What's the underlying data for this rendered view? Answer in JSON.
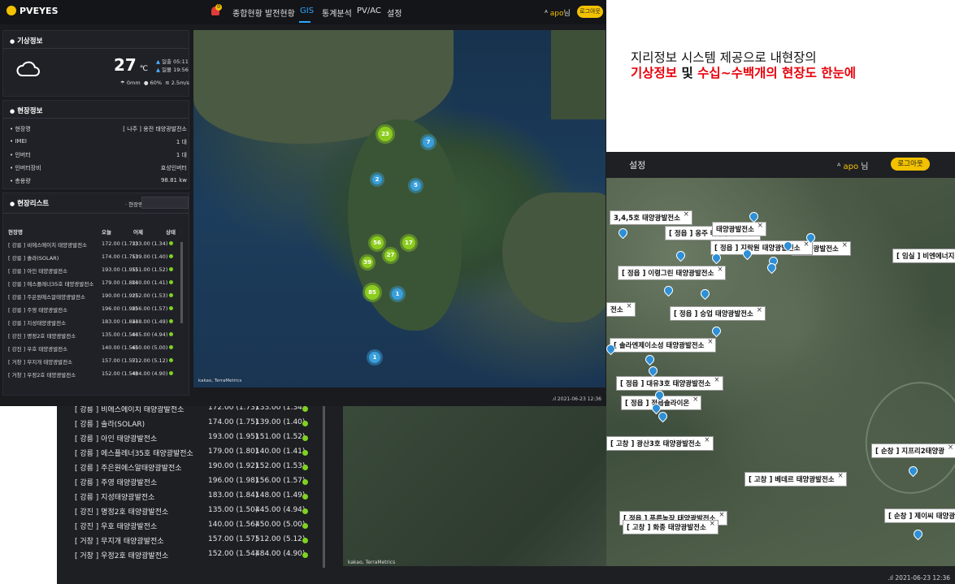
{
  "caption": {
    "line1": "지리정보 시스템 제공으로 내현장의",
    "part1": "기상정보",
    "part2": " 및 ",
    "part3": "수십~수백개의 현장도 한눈에"
  },
  "front": {
    "brand": "PVEYES",
    "bell_count": "0",
    "nav": [
      "종합현황",
      "발전현황",
      "GIS",
      "통계분석",
      "PV/AC",
      "설정"
    ],
    "active_nav": "GIS",
    "user": "apo",
    "user_suffix": "님",
    "logout": "로그아웃",
    "weather": {
      "title": "기상정보",
      "temp": "27",
      "unit": "℃",
      "sunrise": "일출 05:11",
      "sunset": "일몰 19:56",
      "rain": "0mm",
      "humidity": "60%",
      "wind": "2.5m/s"
    },
    "site": {
      "title": "현장정보",
      "rows": [
        {
          "k": "• 현장명",
          "v": "[ 나주 ] 용전 태양광발전소"
        },
        {
          "k": "• IMEI",
          "v": "1 대"
        },
        {
          "k": "• 인버터",
          "v": "1 대"
        },
        {
          "k": "• 인버터장비",
          "v": "효성인버터"
        },
        {
          "k": "• 총용량",
          "v": "98.81 kw"
        }
      ]
    },
    "list": {
      "title": "현장리스트",
      "search_label": "· 현장명",
      "headers": [
        "현장명",
        "오늘",
        "어제",
        "상태"
      ],
      "rows": [
        [
          "[ 강릉 ] 비에스에이치 태양광발전소",
          "172.00 (1.73)",
          "133.00 (1.34)"
        ],
        [
          "[ 강릉 ] 솔라(SOLAR)",
          "174.00 (1.75)",
          "139.00 (1.40)"
        ],
        [
          "[ 강릉 ] 아인 태양광발전소",
          "193.00 (1.95)",
          "151.00 (1.52)"
        ],
        [
          "[ 강릉 ] 에스플레너35호 태양광발전소",
          "179.00 (1.80)",
          "140.00 (1.41)"
        ],
        [
          "[ 강릉 ] 주은원에스알태양광발전소",
          "190.00 (1.92)",
          "152.00 (1.53)"
        ],
        [
          "[ 강릉 ] 주영 태양광발전소",
          "196.00 (1.98)",
          "156.00 (1.57)"
        ],
        [
          "[ 강릉 ] 지성태양광발전소",
          "183.00 (1.84)",
          "148.00 (1.49)"
        ],
        [
          "[ 강진 ] 명정2호 태양광발전소",
          "135.00 (1.50)",
          "445.00 (4.94)"
        ],
        [
          "[ 강진 ] 우호 태양광발전소",
          "140.00 (1.56)",
          "450.00 (5.00)"
        ],
        [
          "[ 거창 ] 무지개 태양광발전소",
          "157.00 (1.57)",
          "512.00 (5.12)"
        ],
        [
          "[ 거창 ] 우정2호 태양광발전소",
          "152.00 (1.54)",
          "484.00 (4.90)"
        ]
      ]
    },
    "clusters": [
      "23",
      "7",
      "2",
      "5",
      "56",
      "17",
      "39",
      "27",
      "85",
      "1",
      "1"
    ],
    "attribution": "kakao, TerraMetrics",
    "status": ".ıl 2021-06-23  12:36"
  },
  "back": {
    "settings": "설정",
    "user": "apo",
    "user_suffix": "님",
    "logout": "로그아웃",
    "rows": [
      [
        "[ 강릉 ] 비에스에이치 태양광발전소",
        "172.00 (1.73)",
        "133.00 (1.34)"
      ],
      [
        "[ 강릉 ] 솔라(SOLAR)",
        "174.00 (1.75)",
        "139.00 (1.40)"
      ],
      [
        "[ 강릉 ] 아인 태양광발전소",
        "193.00 (1.95)",
        "151.00 (1.52)"
      ],
      [
        "[ 강릉 ] 에스플레너35호 태양광발전소",
        "179.00 (1.80)",
        "140.00 (1.41)"
      ],
      [
        "[ 강릉 ] 주은원에스알태양광발전소",
        "190.00 (1.92)",
        "152.00 (1.53)"
      ],
      [
        "[ 강릉 ] 주영 태양광발전소",
        "196.00 (1.98)",
        "156.00 (1.57)"
      ],
      [
        "[ 강릉 ] 지성태양광발전소",
        "183.00 (1.84)",
        "148.00 (1.49)"
      ],
      [
        "[ 강진 ] 명정2호 태양광발전소",
        "135.00 (1.50)",
        "445.00 (4.94)"
      ],
      [
        "[ 강진 ] 우호 태양광발전소",
        "140.00 (1.56)",
        "450.00 (5.00)"
      ],
      [
        "[ 거창 ] 무지개 태양광발전소",
        "157.00 (1.57)",
        "512.00 (5.12)"
      ],
      [
        "[ 거창 ] 우정2호 태양광발전소",
        "152.00 (1.54)",
        "484.00 (4.90)"
      ]
    ],
    "attribution": "kakao, TerraMetrics",
    "status": ".ıl 2021-06-23  12:36"
  },
  "map_labels": [
    "3,4,5호 태양광발전소",
    "[ 정읍 ] 옹주 태양광발전소",
    "태양광발전소",
    "1태양광발전소",
    "[ 정읍 ] 지락원 태양광발전소",
    "[ 임실 ] 비엔에너지",
    "[ 정읍 ] 이령그린 태양광발전소",
    "전소",
    "[ 정읍 ] 승업 태양광발전소",
    "[ 솔라엔제이소성 태양광발전소",
    "[ 정읍 ] 대유3호 태양광발전소",
    "[ 정읍 ] 정읍솔라이온",
    "[ 고창 ] 광산3호 태양광발전소",
    "[ 고창 ] 베데르 태양광발전소",
    "[ 순창 ] 지프리2태양광",
    "[ 정읍 ] 푸른농장 태양광발전소",
    "[ 고창 ] 화종 태양광발전소",
    "[ 순창 ] 제이씨 태양광"
  ]
}
